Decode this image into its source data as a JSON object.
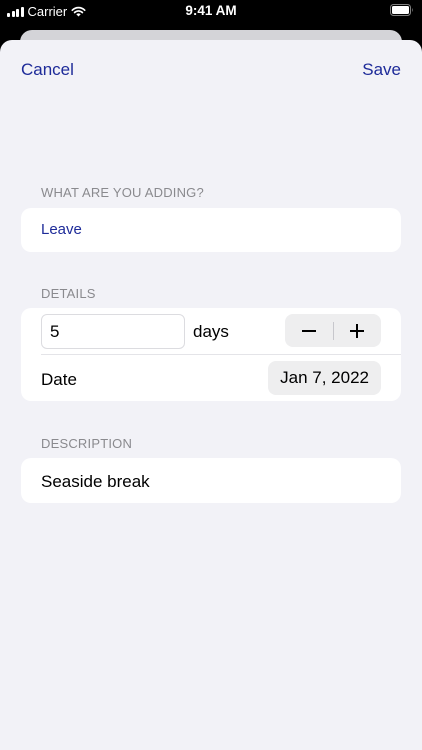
{
  "status_bar": {
    "carrier": "Carrier",
    "time": "9:41 AM"
  },
  "nav": {
    "cancel_label": "Cancel",
    "save_label": "Save"
  },
  "type_section": {
    "header": "WHAT ARE YOU ADDING?",
    "value": "Leave"
  },
  "details_section": {
    "header": "DETAILS",
    "days_value": "5",
    "days_unit": "days",
    "decrement_symbol": "−",
    "increment_symbol": "+",
    "date_label": "Date",
    "date_value": "Jan 7, 2022"
  },
  "description_section": {
    "header": "DESCRIPTION",
    "value": "Seaside break"
  },
  "colors": {
    "accent": "#1e2b99",
    "sheet_background": "#f2f2f7",
    "secondary_text": "#8a8a8e"
  }
}
